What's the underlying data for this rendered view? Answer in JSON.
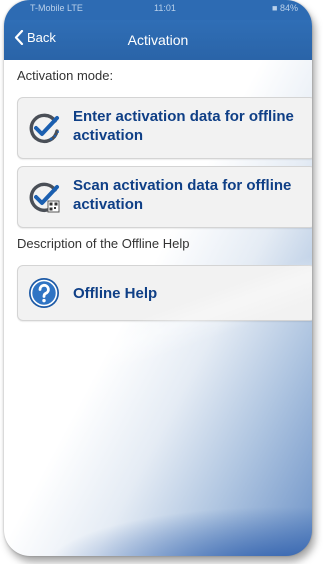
{
  "statusbar": {
    "carrier": "T-Mobile  LTE",
    "time": "11:01",
    "battery": "84%"
  },
  "navbar": {
    "back_label": "Back",
    "title": "Activation"
  },
  "activation_mode": {
    "label": "Activation mode:",
    "options": [
      {
        "label": "Enter activation data for offline activation",
        "icon": "check-edit-icon"
      },
      {
        "label": "Scan activation data for offline activation",
        "icon": "check-qr-scan-icon"
      }
    ]
  },
  "help_section": {
    "label": "Description of the Offline Help",
    "button_label": "Offline Help",
    "icon": "help-circle-icon"
  },
  "colors": {
    "navbar": "#2d6bb3",
    "accent_text": "#0f3f86",
    "button_bg": "#f2f2f2"
  }
}
